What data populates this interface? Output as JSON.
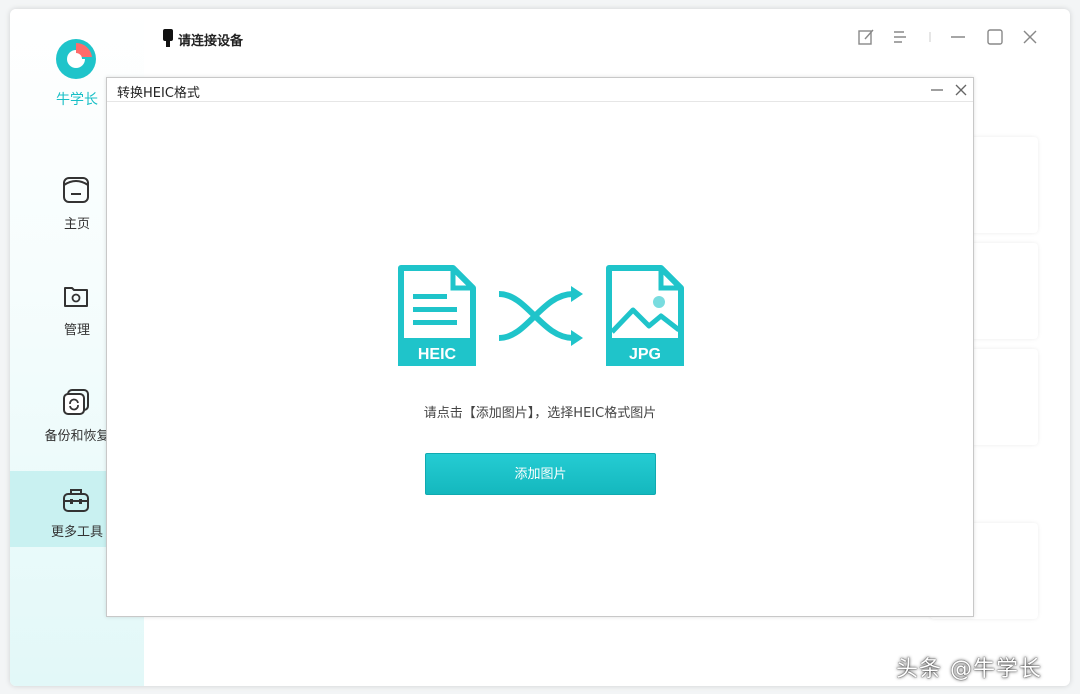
{
  "app": {
    "logo_text": "牛学长",
    "connection_status": "请连接设备"
  },
  "sidebar": {
    "items": [
      {
        "label": "主页",
        "icon": "home-icon"
      },
      {
        "label": "管理",
        "icon": "folder-gear-icon"
      },
      {
        "label": "备份和恢复",
        "icon": "backup-restore-icon"
      },
      {
        "label": "更多工具",
        "icon": "toolbox-icon",
        "active": true
      }
    ]
  },
  "window_controls": [
    "feedback-icon",
    "menu-icon",
    "minimize-icon",
    "maximize-icon",
    "close-icon"
  ],
  "dialog": {
    "title": "转换HEIC格式",
    "source_label": "HEIC",
    "target_label": "JPG",
    "hint": "请点击【添加图片】，选择HEIC格式图片",
    "add_button": "添加图片"
  },
  "watermark": "头条 @牛学长",
  "colors": {
    "accent": "#1fc4ca",
    "sidebar_active": "#c9f1f1"
  }
}
